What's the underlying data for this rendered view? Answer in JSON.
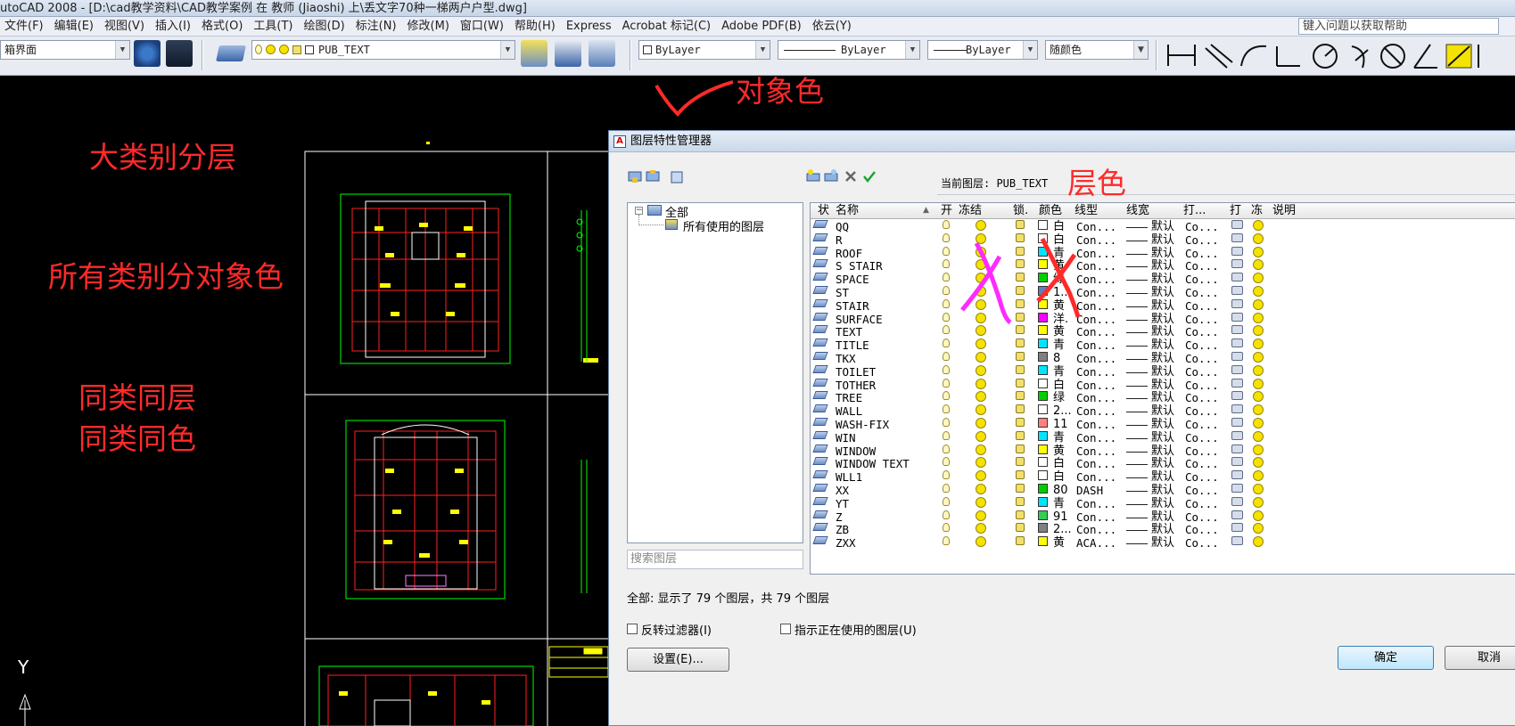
{
  "app": {
    "title": "utoCAD 2008 - [D:\\cad教学资料\\CAD教学案例 在 教师 (Jiaoshi) 上\\丢文字70种一梯两户户型.dwg]"
  },
  "menu": [
    "文件(F)",
    "编辑(E)",
    "视图(V)",
    "插入(I)",
    "格式(O)",
    "工具(T)",
    "绘图(D)",
    "标注(N)",
    "修改(M)",
    "窗口(W)",
    "帮助(H)",
    "Express",
    "Acrobat 标记(C)",
    "Adobe PDF(B)",
    "依云(Y)"
  ],
  "help_placeholder": "键入问题以获取帮助",
  "toolbar": {
    "workspace": "箱界面",
    "layer_combo": "PUB_TEXT",
    "color_combo": "ByLayer",
    "linetype_combo": "ByLayer",
    "lineweight_combo": "ByLayer",
    "plotstyle_combo": "随颜色"
  },
  "annotations": {
    "object_color": "对象色",
    "big_category": "大类别分层",
    "all_category": "所有类别分对象色",
    "same_layer": "同类同层",
    "same_color": "同类同色",
    "layer_color": "层色"
  },
  "ucs": {
    "y": "Y"
  },
  "dialog": {
    "title": "图层特性管理器",
    "current_layer_label": "当前图层: PUB_TEXT",
    "tree_all": "全部",
    "tree_used": "所有使用的图层",
    "search_placeholder": "搜索图层",
    "status": "全部: 显示了 79 个图层，共 79 个图层",
    "invert_filter": "反转过滤器(I)",
    "indicate_used": "指示正在使用的图层(U)",
    "settings_button": "设置(E)...",
    "ok_button": "确定",
    "cancel_button": "取消",
    "columns": [
      "状",
      "名称",
      "开",
      "冻结",
      "锁.",
      "颜色",
      "线型",
      "线宽",
      "打...",
      "打",
      "冻",
      "说明"
    ],
    "layers": [
      {
        "name": "QQ",
        "color": "白",
        "swatch": "#ffffff",
        "linetype": "Con...",
        "lw": "默认",
        "plot": "Co..."
      },
      {
        "name": "R",
        "color": "白",
        "swatch": "#ffffff",
        "linetype": "Con...",
        "lw": "默认",
        "plot": "Co..."
      },
      {
        "name": "ROOF",
        "color": "青",
        "swatch": "#00e5ff",
        "linetype": "Con...",
        "lw": "默认",
        "plot": "Co..."
      },
      {
        "name": "S STAIR",
        "color": "黄",
        "swatch": "#ffff00",
        "linetype": "Con...",
        "lw": "默认",
        "plot": "Co..."
      },
      {
        "name": "SPACE",
        "color": "绿",
        "swatch": "#00d000",
        "linetype": "Con...",
        "lw": "默认",
        "plot": "Co..."
      },
      {
        "name": "ST",
        "color": "1...",
        "swatch": "#5b7fbf",
        "linetype": "Con...",
        "lw": "默认",
        "plot": "Co..."
      },
      {
        "name": "STAIR",
        "color": "黄",
        "swatch": "#ffff00",
        "linetype": "Con...",
        "lw": "默认",
        "plot": "Co..."
      },
      {
        "name": "SURFACE",
        "color": "洋.",
        "swatch": "#ff00ff",
        "linetype": "Con...",
        "lw": "默认",
        "plot": "Co..."
      },
      {
        "name": "TEXT",
        "color": "黄",
        "swatch": "#ffff00",
        "linetype": "Con...",
        "lw": "默认",
        "plot": "Co..."
      },
      {
        "name": "TITLE",
        "color": "青",
        "swatch": "#00e5ff",
        "linetype": "Con...",
        "lw": "默认",
        "plot": "Co..."
      },
      {
        "name": "TKX",
        "color": "8",
        "swatch": "#808080",
        "linetype": "Con...",
        "lw": "默认",
        "plot": "Co..."
      },
      {
        "name": "TOILET",
        "color": "青",
        "swatch": "#00e5ff",
        "linetype": "Con...",
        "lw": "默认",
        "plot": "Co..."
      },
      {
        "name": "TOTHER",
        "color": "白",
        "swatch": "#ffffff",
        "linetype": "Con...",
        "lw": "默认",
        "plot": "Co..."
      },
      {
        "name": "TREE",
        "color": "绿",
        "swatch": "#00d000",
        "linetype": "Con...",
        "lw": "默认",
        "plot": "Co..."
      },
      {
        "name": "WALL",
        "color": "2...",
        "swatch": "#ffffff",
        "linetype": "Con...",
        "lw": "默认",
        "plot": "Co..."
      },
      {
        "name": "WASH-FIX",
        "color": "11",
        "swatch": "#ff8080",
        "linetype": "Con...",
        "lw": "默认",
        "plot": "Co..."
      },
      {
        "name": "WIN",
        "color": "青",
        "swatch": "#00e5ff",
        "linetype": "Con...",
        "lw": "默认",
        "plot": "Co..."
      },
      {
        "name": "WINDOW",
        "color": "黄",
        "swatch": "#ffff00",
        "linetype": "Con...",
        "lw": "默认",
        "plot": "Co..."
      },
      {
        "name": "WINDOW TEXT",
        "color": "白",
        "swatch": "#ffffff",
        "linetype": "Con...",
        "lw": "默认",
        "plot": "Co..."
      },
      {
        "name": "WLL1",
        "color": "白",
        "swatch": "#ffffff",
        "linetype": "Con...",
        "lw": "默认",
        "plot": "Co..."
      },
      {
        "name": "XX",
        "color": "80",
        "swatch": "#00cc00",
        "linetype": "DASH",
        "lw": "默认",
        "plot": "Co..."
      },
      {
        "name": "YT",
        "color": "青",
        "swatch": "#00e5ff",
        "linetype": "Con...",
        "lw": "默认",
        "plot": "Co..."
      },
      {
        "name": "Z",
        "color": "91",
        "swatch": "#33cc55",
        "linetype": "Con...",
        "lw": "默认",
        "plot": "Co..."
      },
      {
        "name": "ZB",
        "color": "2...",
        "swatch": "#808080",
        "linetype": "Con...",
        "lw": "默认",
        "plot": "Co..."
      },
      {
        "name": "ZXX",
        "color": "黄",
        "swatch": "#ffff00",
        "linetype": "ACA...",
        "lw": "默认",
        "plot": "Co..."
      }
    ]
  }
}
